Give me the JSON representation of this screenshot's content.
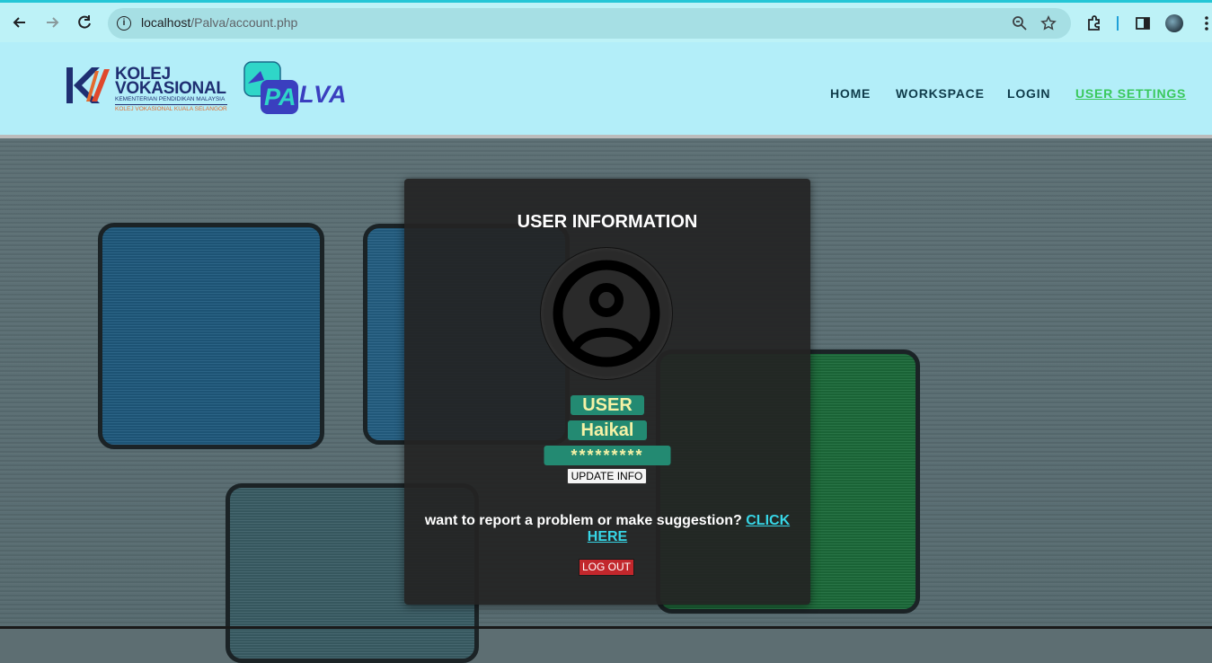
{
  "browser": {
    "url_host": "localhost",
    "url_path": "/Palva/account.php",
    "icons": [
      "back-icon",
      "forward-icon",
      "reload-icon",
      "info-icon",
      "zoom-icon",
      "star-icon",
      "extensions-icon",
      "sidebar-icon",
      "profile-avatar",
      "more-icon"
    ]
  },
  "header": {
    "logo_line1": "KOLEJ",
    "logo_line2": "VOKASIONAL",
    "logo_sub": "KEMENTERIAN PENDIDIKAN MALAYSIA",
    "logo_sub2": "KOLEJ VOKASIONAL KUALA SELANGOR",
    "app_logo": "LVA",
    "app_logo_badge": "PA",
    "nav": [
      "HOME",
      "WORKSPACE",
      "LOGIN",
      "USER SETTINGS"
    ],
    "active_nav": "USER SETTINGS"
  },
  "panel": {
    "title": "USER INFORMATION",
    "role": "USER",
    "username": "Haikal",
    "password_masked": "*********",
    "update_button": "UPDATE INFO",
    "report_text": "want to report a problem or make suggestion?",
    "report_link": "CLICK HERE",
    "logout_button": "LOG OUT"
  },
  "colors": {
    "chrome_bg": "#bdf2f7",
    "header_bg": "#b3eef9",
    "nav_active": "#3ac85b",
    "pill_bg": "#238a72",
    "pill_text": "#f6f2a6",
    "link": "#37d6e6",
    "logout_bg": "#c2272c"
  }
}
